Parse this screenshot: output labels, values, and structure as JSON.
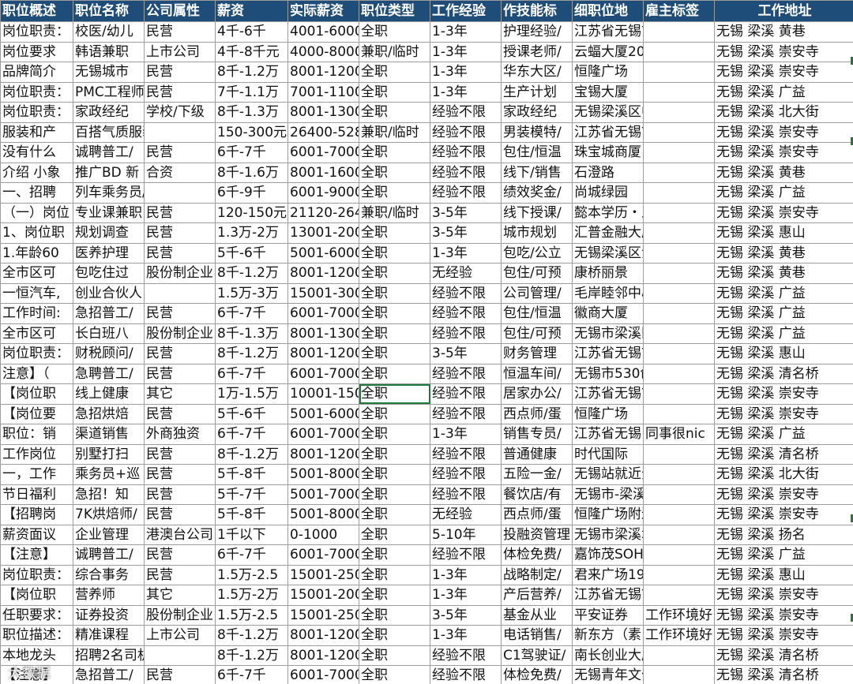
{
  "headers": [
    "职位概述",
    "职位名称",
    "公司属性",
    "薪资",
    "实际薪资",
    "职位类型",
    "工作经验",
    "作技能标",
    "细职位地",
    "雇主标签",
    "工作地址"
  ],
  "rows": [
    [
      "岗位职责：",
      "校医/幼儿",
      "民营",
      "4千-6千",
      "4001-6000",
      "全职",
      "1-3年",
      "护理经验/",
      "江苏省无锡市梁溪区",
      "",
      "无锡 梁溪 黄巷"
    ],
    [
      "岗位要求",
      "韩语兼职",
      "上市公司",
      "4千-8千元",
      "4000-8000",
      "兼职/临时",
      "1-3年",
      "授课老师/",
      "云蝠大厦20楼",
      "",
      "无锡 梁溪 崇安寺"
    ],
    [
      "品牌简介",
      "无锡城市",
      "民营",
      "8千-1.2万",
      "8001-1200",
      "全职",
      "1-3年",
      "华东大区/",
      "恒隆广场",
      "",
      "无锡 梁溪 崇安寺"
    ],
    [
      "岗位职责：",
      "PMC工程师",
      "民营",
      "7千-1.1万",
      "7001-1100",
      "全职",
      "1-3年",
      "生产计划",
      "宝锡大厦",
      "",
      "无锡 梁溪 广益"
    ],
    [
      "岗位职责：",
      "家政经纪",
      "学校/下级",
      "8千-1.3万",
      "8001-1300",
      "全职",
      "经验不限",
      "家政经纪",
      "无锡梁溪区中山路72",
      "",
      "无锡 梁溪 北大街"
    ],
    [
      "服装和产",
      "百搭气质服装试衣模",
      "",
      "150-300元",
      "26400-528",
      "兼职/临时",
      "经验不限",
      "男装模特/",
      "江苏省无锡市梁溪区",
      "",
      "无锡 梁溪 崇安寺"
    ],
    [
      "没有什么",
      "诚聘普工/",
      "民营",
      "6千-7千",
      "6001-7000",
      "全职",
      "经验不限",
      "包住/恒温",
      "珠宝城商厦",
      "",
      "无锡 梁溪 崇安寺"
    ],
    [
      "介绍 小象",
      "推广BD 新",
      "合资",
      "8千-1.6万",
      "8001-1600",
      "全职",
      "经验不限",
      "线下/销售",
      "石澄路",
      "",
      "无锡 梁溪 黄巷"
    ],
    [
      "一、招聘",
      "列车乘务员/上几休",
      "",
      "6千-9千",
      "6001-9000",
      "全职",
      "经验不限",
      "绩效奖金/",
      "尚城绿园",
      "",
      "无锡 梁溪 广益"
    ],
    [
      "（一）岗位",
      "专业课兼职",
      "民营",
      "120-150元",
      "21120-264",
      "兼职/临时",
      "3-5年",
      "线下授课/",
      "懿本学历・五年制专",
      "",
      "无锡 梁溪 崇安寺"
    ],
    [
      "1、岗位职",
      "规划调查",
      "民营",
      "1.3万-2万",
      "13001-200",
      "全职",
      "3-5年",
      "城市规划",
      "汇普金融大厦20楼",
      "",
      "无锡 梁溪 惠山"
    ],
    [
      "1.年龄60",
      "医养护理",
      "民营",
      "5千-6千",
      "5001-6000",
      "全职",
      "1-3年",
      "包吃/公立",
      "无锡梁溪区江海东路",
      "",
      "无锡 梁溪 黄巷"
    ],
    [
      "全市区可",
      "包吃住过",
      "股份制企业",
      "8千-1.2万",
      "8001-1200",
      "全职",
      "无经验",
      "包住/可预",
      "康桥丽景",
      "",
      "无锡 梁溪 黄巷"
    ],
    [
      "一恒汽车,",
      "创业合伙人",
      "",
      "1.5万-3万",
      "15001-300",
      "全职",
      "经验不限",
      "公司管理/",
      "毛岸睦邻中心",
      "",
      "无锡 梁溪 广益"
    ],
    [
      "工作时间:",
      "急招普工/",
      "民营",
      "6千-7千",
      "6001-7000",
      "全职",
      "经验不限",
      "包住/恒温",
      "徽商大厦",
      "",
      "无锡 梁溪 广益"
    ],
    [
      "全市区可",
      "长白班八",
      "股份制企业",
      "8千-1.3万",
      "8001-1300",
      "全职",
      "经验不限",
      "包住/可预",
      "无锡市梁溪区广益街",
      "",
      "无锡 梁溪 广益"
    ],
    [
      "岗位职责：",
      "财税顾问/",
      "民营",
      "8千-1.2万",
      "8001-1200",
      "全职",
      "3-5年",
      "财务管理",
      "江苏省无锡市梁溪区",
      "",
      "无锡 梁溪 惠山"
    ],
    [
      "注意】（",
      "急聘普工/",
      "民营",
      "6千-7千",
      "6001-7000",
      "全职",
      "经验不限",
      "恒温车间/",
      "无锡市530创业人才",
      "",
      "无锡 梁溪 清名桥"
    ],
    [
      "【岗位职",
      "线上健康",
      "其它",
      "1万-1.5万",
      "10001-150",
      "全职",
      "经验不限",
      "居家办公/",
      "江苏省无锡市梁溪区",
      "",
      "无锡 梁溪 崇安寺"
    ],
    [
      "【岗位要",
      "急招烘焙",
      "民营",
      "5千-6千",
      "5001-6000",
      "全职",
      "经验不限",
      "西点师/蛋",
      "恒隆广场",
      "",
      "无锡 梁溪 崇安寺"
    ],
    [
      "职位：销",
      "渠道销售",
      "外商独资",
      "6千-7千",
      "6001-7000",
      "全职",
      "1-3年",
      "销售专员/",
      "江苏省无锡",
      "同事很nic",
      "无锡 梁溪 广益"
    ],
    [
      "工作岗位",
      "别墅打扫",
      "民营",
      "8千-1.2万",
      "8001-1200",
      "全职",
      "经验不限",
      "普通健康",
      "时代国际",
      "",
      "无锡 梁溪 清名桥"
    ],
    [
      "一，工作",
      "乘务员+巡",
      "民营",
      "5千-8千",
      "5001-8000",
      "全职",
      "经验不限",
      "五险一金/",
      "无锡站就近分配",
      "",
      "无锡 梁溪 北大街"
    ],
    [
      "节日福利",
      "急招！知",
      "民营",
      "5千-7千",
      "5001-7000",
      "全职",
      "经验不限",
      "餐饮店/有",
      "无锡市-梁溪区-学前",
      "",
      "无锡 梁溪 崇安寺"
    ],
    [
      "【招聘岗",
      "7K烘焙师/",
      "民营",
      "5千-8千",
      "5001-8000",
      "全职",
      "无经验",
      "西点师/蛋",
      "恒隆广场附近",
      "",
      "无锡 梁溪 崇安寺"
    ],
    [
      "薪资面议",
      "企业管理",
      "港澳台公司",
      "1千以下",
      "0-1000",
      "全职",
      "5-10年",
      "投融资管理",
      "无锡市梁溪城市投资",
      "",
      "无锡 梁溪 扬名"
    ],
    [
      "【注意】",
      "诚聘普工/",
      "民营",
      "6千-7千",
      "6001-7000",
      "全职",
      "经验不限",
      "体检免费/",
      "嘉饰茂SOHO中心",
      "",
      "无锡 梁溪 广益"
    ],
    [
      "岗位职责：",
      "综合事务",
      "民营",
      "1.5万-2.5",
      "15001-250",
      "全职",
      "1-3年",
      "战略制定/",
      "君来广场19层",
      "",
      "无锡 梁溪 惠山"
    ],
    [
      "【岗位职",
      "营养师",
      "其它",
      "1.5万-2万",
      "15001-200",
      "全职",
      "1-3年",
      "产后营养/",
      "江苏省无锡市梁溪区",
      "",
      "无锡 梁溪 崇安寺"
    ],
    [
      "任职要求：",
      "证券投资",
      "股份制企业",
      "1.5万-2.5",
      "15001-250",
      "全职",
      "3-5年",
      "基金从业",
      "平安证券",
      "工作环境好",
      "无锡 梁溪 崇安寺"
    ],
    [
      "职位描述：",
      "精准课程",
      "上市公司",
      "8千-1.2万",
      "8001-1200",
      "全职",
      "1-3年",
      "电话销售/",
      "新东方（素",
      "工作环境好",
      "无锡 梁溪 崇安寺"
    ],
    [
      "本地龙头",
      "招聘2名司机负责开",
      "",
      "8千-1.2万",
      "8001-1200",
      "全职",
      "经验不限",
      "C1驾驶证/",
      "南长创业大厦",
      "",
      "无锡 梁溪 清名桥"
    ],
    [
      "【注意】",
      "急招普工/",
      "民营",
      "6千-7千",
      "6001-7000",
      "全职",
      "经验不限",
      "体检免费/",
      "无锡青年文化活动中",
      "",
      "无锡 梁溪 清名桥"
    ]
  ],
  "selected_cell": {
    "row": 18,
    "col": 5
  },
  "watermark": "大数据"
}
